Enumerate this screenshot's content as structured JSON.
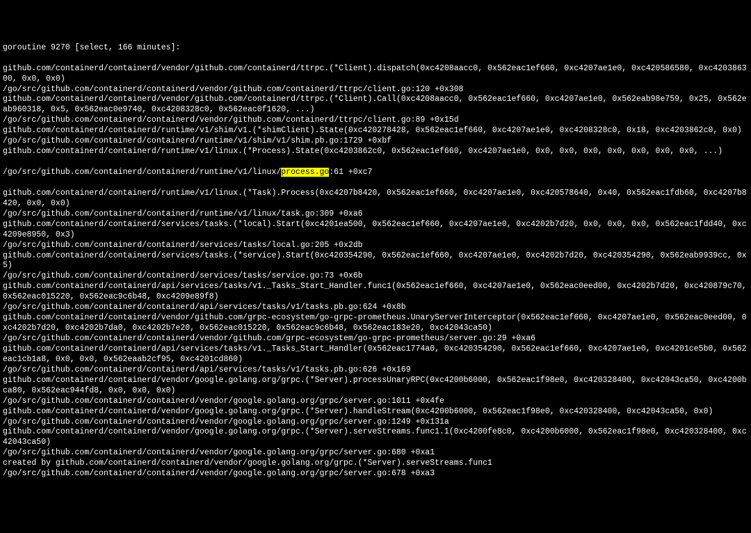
{
  "header": "goroutine 9270 [select, 166 minutes]:",
  "lines": [
    "github.com/containerd/containerd/vendor/github.com/containerd/ttrpc.(*Client).dispatch(0xc4208aacc0, 0x562eac1ef660, 0xc4207ae1e0, 0xc420586580, 0xc420386300, 0x0, 0x0)",
    "/go/src/github.com/containerd/containerd/vendor/github.com/containerd/ttrpc/client.go:120 +0x308",
    "github.com/containerd/containerd/vendor/github.com/containerd/ttrpc.(*Client).Call(0xc4208aacc0, 0x562eac1ef660, 0xc4207ae1e0, 0x562eab98e759, 0x25, 0x562eab960318, 0x5, 0x562eac0e9740, 0xc4208328c0, 0x562eac0f1620, ...)",
    "/go/src/github.com/containerd/containerd/vendor/github.com/containerd/ttrpc/client.go:89 +0x15d",
    "github.com/containerd/containerd/runtime/v1/shim/v1.(*shimClient).State(0xc420278428, 0x562eac1ef660, 0xc4207ae1e0, 0xc4208328c0, 0x18, 0xc4203862c0, 0x0)",
    "/go/src/github.com/containerd/containerd/runtime/v1/shim/v1/shim.pb.go:1729 +0xbf",
    "github.com/containerd/containerd/runtime/v1/linux.(*Process).State(0xc4203862c0, 0x562eac1ef660, 0xc4207ae1e0, 0x0, 0x0, 0x0, 0x0, 0x0, 0x0, 0x0, ...)"
  ],
  "highlight_line": {
    "prefix": "/go/src/github.com/containerd/containerd/runtime/v1/linux/",
    "highlighted": "process.go",
    "suffix": ":61 +0xc7"
  },
  "lines2": [
    "github.com/containerd/containerd/runtime/v1/linux.(*Task).Process(0xc4207b8420, 0x562eac1ef660, 0xc4207ae1e0, 0xc420578640, 0x40, 0x562eac1fdb60, 0xc4207b8420, 0x0, 0x0)",
    "/go/src/github.com/containerd/containerd/runtime/v1/linux/task.go:309 +0xa6",
    "github.com/containerd/containerd/services/tasks.(*local).Start(0xc4201ea500, 0x562eac1ef660, 0xc4207ae1e0, 0xc4202b7d20, 0x0, 0x0, 0x0, 0x562eac1fdd40, 0xc4209e8950, 0x3)",
    "/go/src/github.com/containerd/containerd/services/tasks/local.go:205 +0x2db",
    "github.com/containerd/containerd/services/tasks.(*service).Start(0xc420354290, 0x562eac1ef660, 0xc4207ae1e0, 0xc4202b7d20, 0xc420354290, 0x562eab9939cc, 0x5)",
    "/go/src/github.com/containerd/containerd/services/tasks/service.go:73 +0x6b",
    "github.com/containerd/containerd/api/services/tasks/v1._Tasks_Start_Handler.func1(0x562eac1ef660, 0xc4207ae1e0, 0x562eac0eed00, 0xc4202b7d20, 0xc420879c70, 0x562eac015220, 0x562eac9c6b48, 0xc4209e89f8)",
    "/go/src/github.com/containerd/containerd/api/services/tasks/v1/tasks.pb.go:624 +0x8b",
    "github.com/containerd/containerd/vendor/github.com/grpc-ecosystem/go-grpc-prometheus.UnaryServerInterceptor(0x562eac1ef660, 0xc4207ae1e0, 0x562eac0eed00, 0xc4202b7d20, 0xc4202b7da0, 0xc4202b7e20, 0x562eac015220, 0x562eac9c6b48, 0x562eac183e20, 0xc42043ca50)",
    "/go/src/github.com/containerd/containerd/vendor/github.com/grpc-ecosystem/go-grpc-prometheus/server.go:29 +0xa6",
    "github.com/containerd/containerd/api/services/tasks/v1._Tasks_Start_Handler(0x562eac1774a0, 0xc420354290, 0x562eac1ef660, 0xc4207ae1e0, 0xc4201ce5b0, 0x562eac1cb1a8, 0x0, 0x0, 0x562eaab2cf95, 0xc4201cd860)",
    "/go/src/github.com/containerd/containerd/api/services/tasks/v1/tasks.pb.go:626 +0x169",
    "github.com/containerd/containerd/vendor/google.golang.org/grpc.(*Server).processUnaryRPC(0xc4200b6000, 0x562eac1f98e0, 0xc420328400, 0xc42043ca50, 0xc4200bca80, 0x562eac944fd8, 0x0, 0x0, 0x0)",
    "/go/src/github.com/containerd/containerd/vendor/google.golang.org/grpc/server.go:1011 +0x4fe",
    "github.com/containerd/containerd/vendor/google.golang.org/grpc.(*Server).handleStream(0xc4200b6000, 0x562eac1f98e0, 0xc420328400, 0xc42043ca50, 0x0)",
    "/go/src/github.com/containerd/containerd/vendor/google.golang.org/grpc/server.go:1249 +0x131a",
    "github.com/containerd/containerd/vendor/google.golang.org/grpc.(*Server).serveStreams.func1.1(0xc4200fe8c0, 0xc4200b6000, 0x562eac1f98e0, 0xc420328400, 0xc42043ca50)",
    "/go/src/github.com/containerd/containerd/vendor/google.golang.org/grpc/server.go:680 +0xa1",
    "created by github.com/containerd/containerd/vendor/google.golang.org/grpc.(*Server).serveStreams.func1",
    "/go/src/github.com/containerd/containerd/vendor/google.golang.org/grpc/server.go:678 +0xa3"
  ]
}
